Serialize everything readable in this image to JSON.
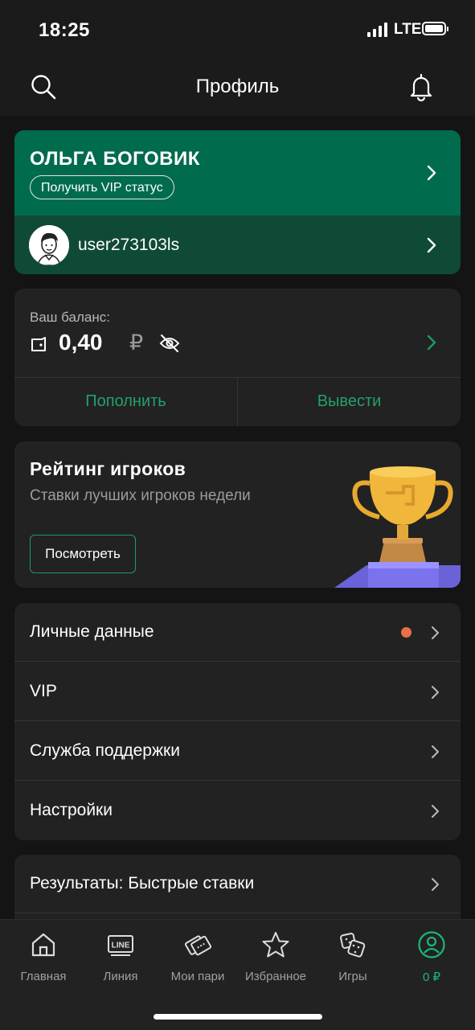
{
  "status_bar": {
    "time": "18:25",
    "network": "LTE"
  },
  "header": {
    "title": "Профиль",
    "left_icon": "search-icon",
    "right_icon": "bell-icon"
  },
  "profile": {
    "name": "ОЛЬГА БОГОВИК",
    "vip_button": "Получить VIP статус",
    "username": "user273103ls"
  },
  "balance": {
    "label": "Ваш баланс:",
    "amount": "0,40",
    "currency": "₽",
    "deposit_label": "Пополнить",
    "withdraw_label": "Вывести"
  },
  "rating": {
    "title": "Рейтинг игроков",
    "subtitle": "Ставки лучших игроков недели",
    "button": "Посмотреть"
  },
  "menu": [
    {
      "label": "Личные данные",
      "has_badge": true
    },
    {
      "label": "VIP"
    },
    {
      "label": "Служба поддержки"
    },
    {
      "label": "Настройки"
    }
  ],
  "menu2": [
    {
      "label": "Результаты: Быстрые ставки"
    }
  ],
  "tabs": [
    {
      "label": "Главная",
      "icon": "home-icon"
    },
    {
      "label": "Линия",
      "icon": "line-icon",
      "badge": "LINE"
    },
    {
      "label": "Мои пари",
      "icon": "tickets-icon"
    },
    {
      "label": "Избранное",
      "icon": "star-icon"
    },
    {
      "label": "Игры",
      "icon": "dice-icon"
    },
    {
      "label": "0 ₽",
      "icon": "profile-icon",
      "active": true
    }
  ],
  "colors": {
    "accent_green": "#19b87a",
    "profile_green": "#006b4d",
    "badge_orange": "#e8704a",
    "background": "#141414",
    "card": "#222222"
  }
}
